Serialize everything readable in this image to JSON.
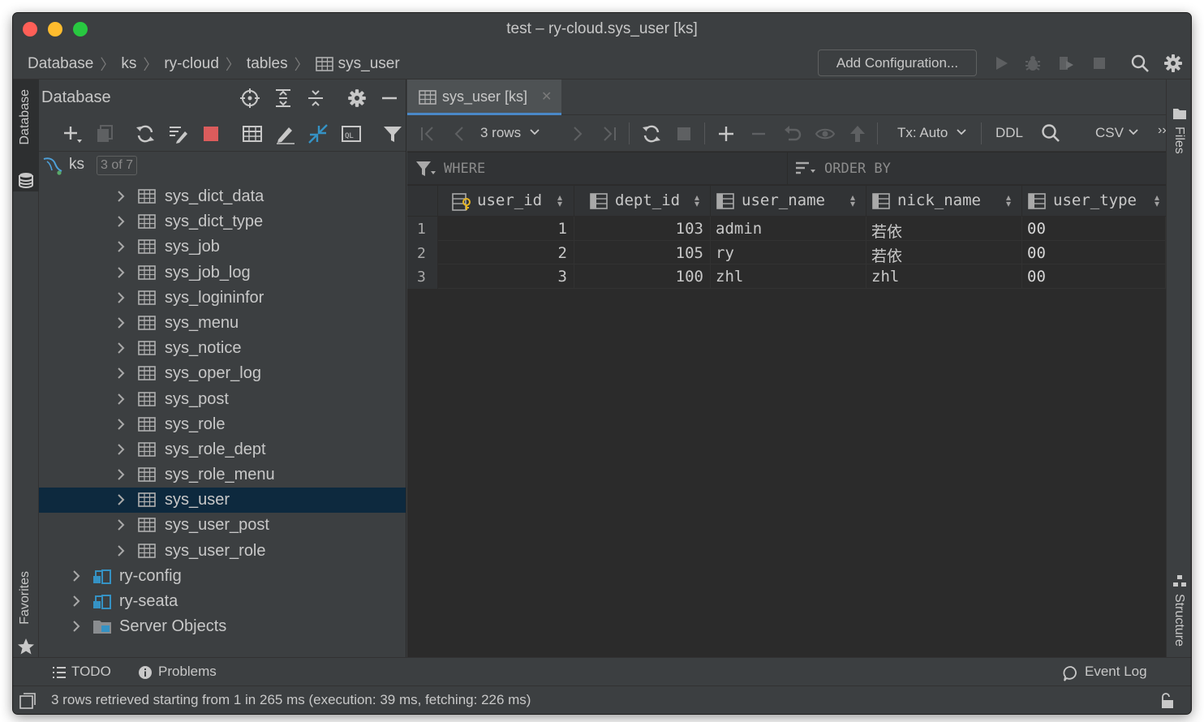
{
  "window": {
    "title": "test – ry-cloud.sys_user [ks]"
  },
  "breadcrumb": [
    "Database",
    "ks",
    "ry-cloud",
    "tables",
    "sys_user"
  ],
  "navbar": {
    "add_configuration_label": "Add Configuration..."
  },
  "left_strip": {
    "database_tab": "Database",
    "favorites_tab": "Favorites"
  },
  "right_strip": {
    "files_tab": "Files",
    "structure_tab": "Structure"
  },
  "db_panel": {
    "title": "Database",
    "schema": "ks",
    "schema_count": "3 of 7",
    "tables": [
      "sys_dict_data",
      "sys_dict_type",
      "sys_job",
      "sys_job_log",
      "sys_logininfor",
      "sys_menu",
      "sys_notice",
      "sys_oper_log",
      "sys_post",
      "sys_role",
      "sys_role_dept",
      "sys_role_menu",
      "sys_user",
      "sys_user_post",
      "sys_user_role"
    ],
    "selected_table": "sys_user",
    "schemas": [
      "ry-config",
      "ry-seata"
    ],
    "server_objects": "Server Objects"
  },
  "editor": {
    "tab_label": "sys_user [ks]",
    "rows_label": "3 rows",
    "tx_label": "Tx: Auto",
    "ddl_label": "DDL",
    "export_format": "CSV",
    "where_label": "WHERE",
    "order_by_label": "ORDER BY",
    "columns": [
      "user_id",
      "dept_id",
      "user_name",
      "nick_name",
      "user_type"
    ],
    "rows": [
      {
        "n": "1",
        "user_id": "1",
        "dept_id": "103",
        "user_name": "admin",
        "nick_name": "若依",
        "user_type": "00"
      },
      {
        "n": "2",
        "user_id": "2",
        "dept_id": "105",
        "user_name": "ry",
        "nick_name": "若依",
        "user_type": "00"
      },
      {
        "n": "3",
        "user_id": "3",
        "dept_id": "100",
        "user_name": "zhl",
        "nick_name": "zhl",
        "user_type": "00"
      }
    ]
  },
  "bottombar": {
    "todo_label": "TODO",
    "problems_label": "Problems",
    "event_log_label": "Event Log"
  },
  "status": {
    "message": "3 rows retrieved starting from 1 in 265 ms (execution: 39 ms, fetching: 226 ms)"
  },
  "colors": {
    "selection": "#0d293e",
    "accent": "#4a88c7",
    "stop_red": "#db5c5c",
    "editor_bg": "#2b2b2b",
    "panel_bg": "#3c3f41"
  }
}
